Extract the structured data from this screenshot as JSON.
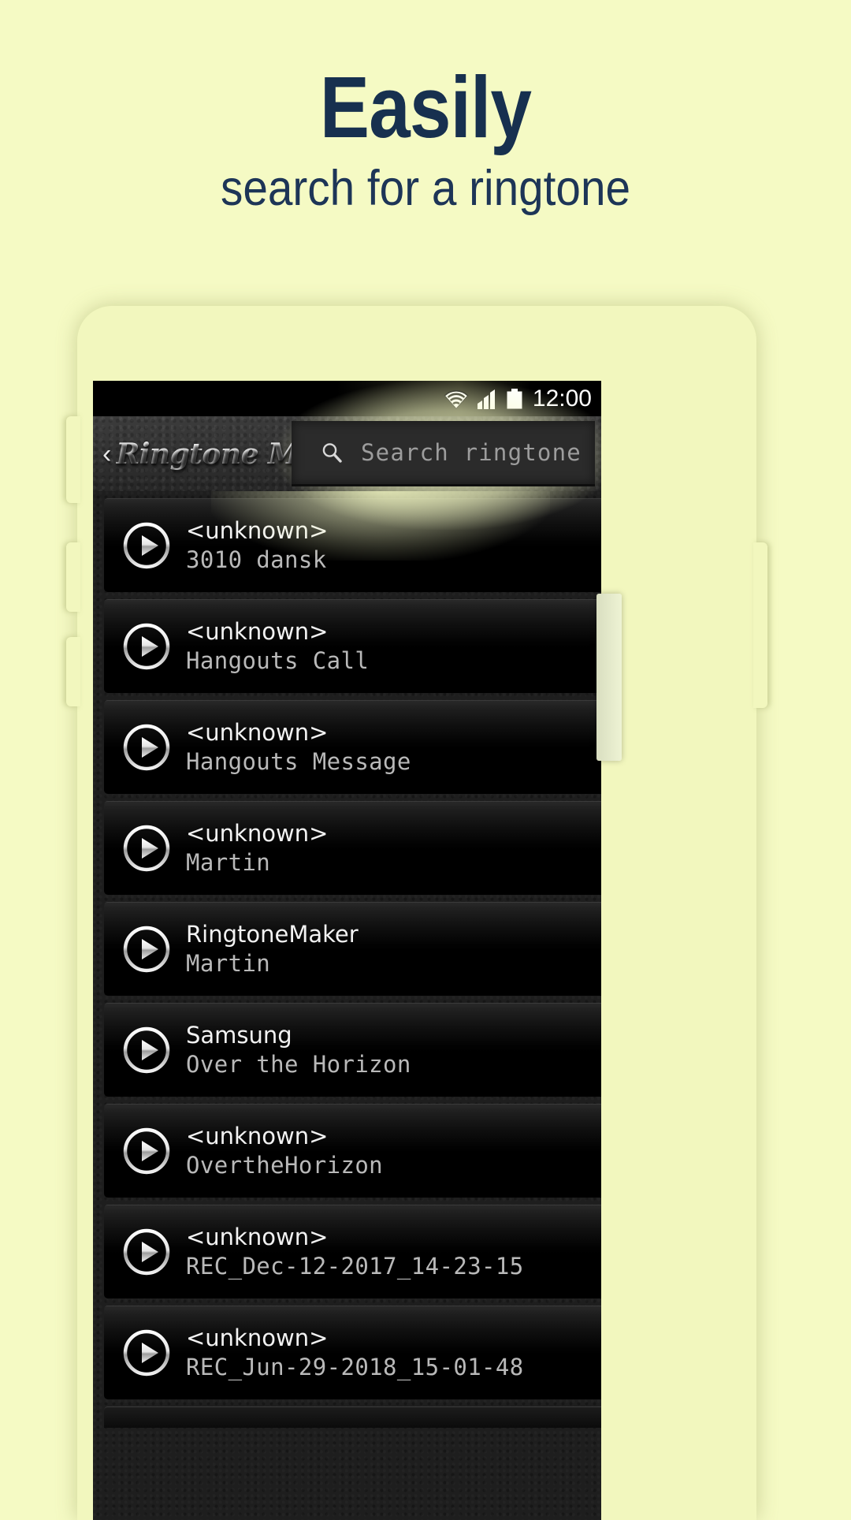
{
  "promo": {
    "headline": "Easily",
    "subheadline": "search for a ringtone",
    "headline_color": "#17304f",
    "background_color": "#f5fac4"
  },
  "statusbar": {
    "wifi_icon": "wifi-icon",
    "signal_icon": "cellular-signal-icon",
    "battery_icon": "battery-icon",
    "clock": "12:00"
  },
  "actionbar": {
    "back_chevron": "‹",
    "app_title": "Ringtone Maker",
    "search": {
      "icon": "search-icon",
      "placeholder": "Search ringtone",
      "value": ""
    }
  },
  "list": {
    "play_icon": "play-circle-icon",
    "items": [
      {
        "artist": "<unknown>",
        "title": "3010 dansk"
      },
      {
        "artist": "<unknown>",
        "title": "Hangouts Call"
      },
      {
        "artist": "<unknown>",
        "title": "Hangouts Message"
      },
      {
        "artist": "<unknown>",
        "title": "Martin"
      },
      {
        "artist": "RingtoneMaker",
        "title": "Martin"
      },
      {
        "artist": "Samsung",
        "title": "Over the Horizon"
      },
      {
        "artist": "<unknown>",
        "title": "OvertheHorizon"
      },
      {
        "artist": "<unknown>",
        "title": "REC_Dec-12-2017_14-23-15"
      },
      {
        "artist": "<unknown>",
        "title": "REC_Jun-29-2018_15-01-48"
      }
    ]
  },
  "device": {
    "body_color": "#f2f7be",
    "scrollbar": "list-scrollbar-thumb",
    "buttons": [
      "power-button",
      "volume-up-button",
      "volume-down-button",
      "right-side-button"
    ]
  }
}
